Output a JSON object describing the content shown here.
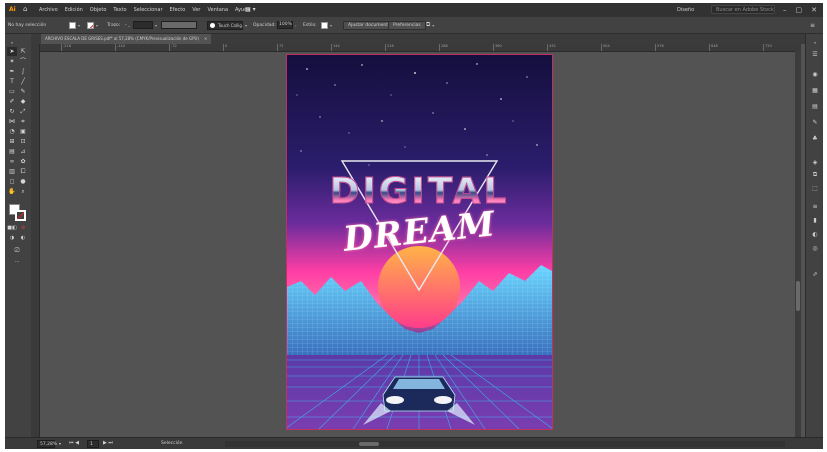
{
  "menubar": {
    "items": [
      "Archivo",
      "Edición",
      "Objeto",
      "Texto",
      "Seleccionar",
      "Efecto",
      "Ver",
      "Ventana",
      "Ayuda"
    ],
    "workspace": "Diseño",
    "search_placeholder": "Buscar en Adobe Stock"
  },
  "controlbar": {
    "selection": "No hay selección",
    "stroke_label": "Trazo:",
    "brush": "Touch Callig.",
    "opacity_label": "Opacidad:",
    "opacity_value": "100%",
    "style_label": "Estilo:",
    "doc_setup_button": "Ajustar documento",
    "preferences_button": "Preferencias"
  },
  "document_tab": {
    "title": "ARCHIVO ESCALA DE GRISES.pdf* al 57,28% (CMYK/Previsualización de GPU)"
  },
  "ruler": {
    "labels": [
      "-216",
      "-144",
      "-72",
      "0",
      "72",
      "144",
      "216",
      "288",
      "360",
      "432",
      "504",
      "576",
      "648",
      "720"
    ]
  },
  "poster": {
    "line1": "DIGITAL",
    "line2": "DREAM"
  },
  "status": {
    "zoom": "57,28%",
    "artboard": "1",
    "tool": "Selección"
  },
  "colors": {
    "app_bg": "#535353",
    "panel_bg": "#424242",
    "menubar_bg": "#323232",
    "sky_top": "#1a1350",
    "sky_pink": "#ff3ea5",
    "sun_top": "#ffb347",
    "sun_bottom": "#ff3d8a",
    "grid_cyan": "#38c8ff",
    "ai_orange": "#ff9a00"
  },
  "icons": {
    "app": "illustrator-logo-icon",
    "home": "home-icon",
    "layout": "workspace-switcher-icon",
    "search": "search-icon"
  }
}
